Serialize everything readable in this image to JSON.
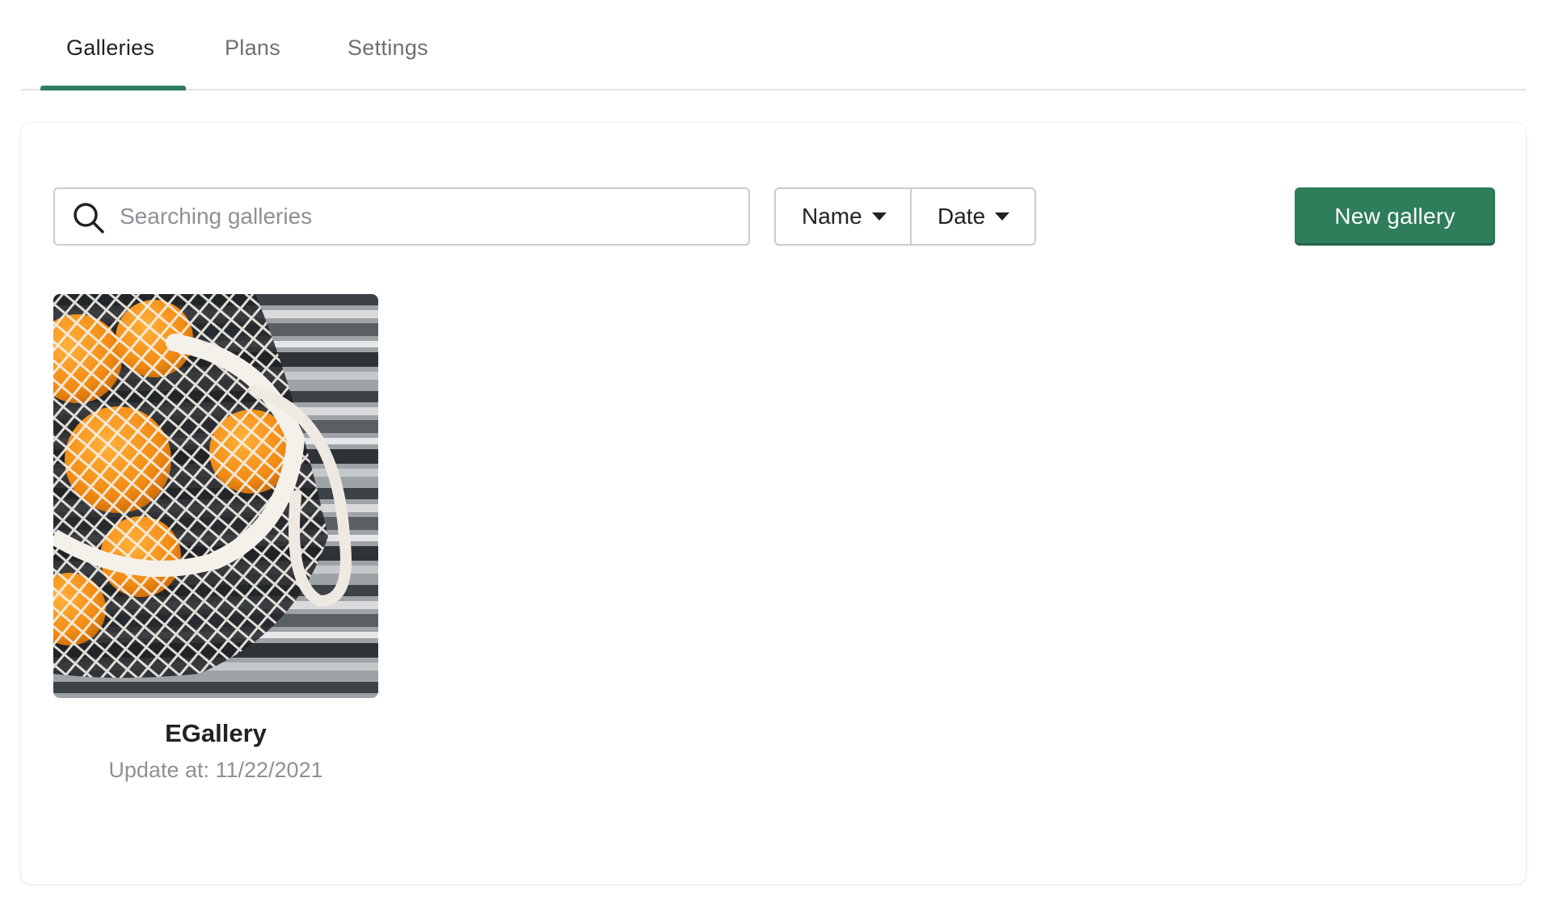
{
  "tabs": [
    {
      "label": "Galleries",
      "active": true
    },
    {
      "label": "Plans",
      "active": false
    },
    {
      "label": "Settings",
      "active": false
    }
  ],
  "toolbar": {
    "search_placeholder": "Searching galleries",
    "search_value": "",
    "sort_name_label": "Name",
    "sort_date_label": "Date",
    "new_gallery_label": "New gallery"
  },
  "galleries": [
    {
      "name": "EGallery",
      "updated": "Update at: 11/22/2021",
      "thumbnail": "oranges-in-mesh-bag-photo"
    }
  ],
  "colors": {
    "accent": "#2e7d5b",
    "muted_text": "#8c9196",
    "border": "#c9cccf"
  },
  "icons": {
    "search": "search-icon",
    "caret": "caret-down-icon"
  }
}
